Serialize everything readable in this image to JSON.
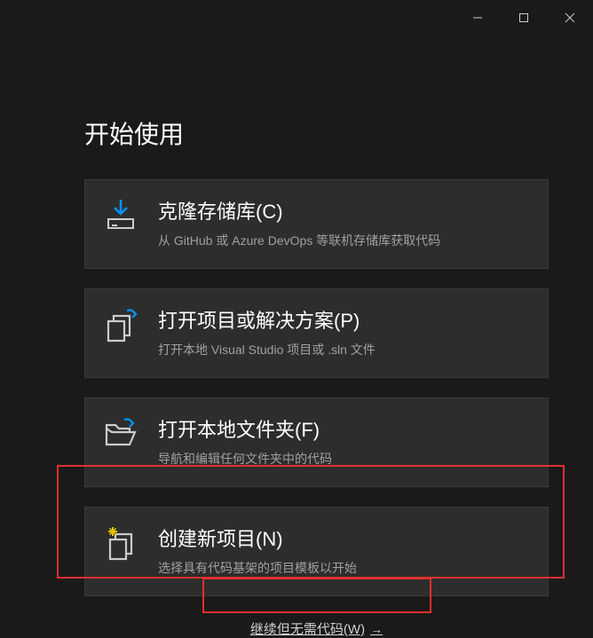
{
  "heading": "开始使用",
  "cards": [
    {
      "title": "克隆存储库(C)",
      "desc": "从 GitHub 或 Azure DevOps 等联机存储库获取代码"
    },
    {
      "title": "打开项目或解决方案(P)",
      "desc": "打开本地 Visual Studio 项目或 .sln 文件"
    },
    {
      "title": "打开本地文件夹(F)",
      "desc": "导航和编辑任何文件夹中的代码"
    },
    {
      "title": "创建新项目(N)",
      "desc": "选择具有代码基架的项目模板以开始"
    }
  ],
  "skip_link": "继续但无需代码(W)"
}
